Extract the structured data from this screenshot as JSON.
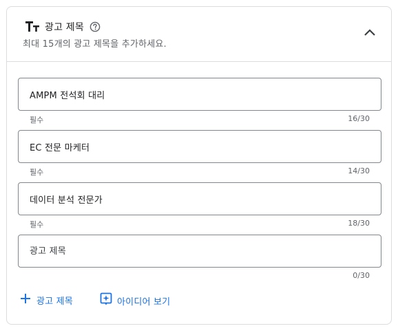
{
  "section": {
    "title": "광고 제목",
    "subtitle": "최대 15개의 광고 제목을 추가하세요.",
    "icons": {
      "type": "text-type-icon",
      "help": "help-icon",
      "collapse": "chevron-up-icon"
    }
  },
  "headlines": [
    {
      "value": "AMPM 전석회 대리",
      "placeholder": "광고 제목",
      "helper": "필수",
      "counter": "16/30"
    },
    {
      "value": "EC 전문 마케터",
      "placeholder": "광고 제목",
      "helper": "필수",
      "counter": "14/30"
    },
    {
      "value": "데이터 분석 전문가",
      "placeholder": "광고 제목",
      "helper": "필수",
      "counter": "18/30"
    },
    {
      "value": "",
      "placeholder": "광고 제목",
      "helper": "",
      "counter": "0/30"
    }
  ],
  "actions": {
    "add_label": "광고 제목",
    "ideas_label": "아이디어 보기"
  },
  "colors": {
    "accent": "#1a73e8",
    "border": "#dadce0",
    "field_border": "#80868b",
    "secondary_text": "#5f6368"
  }
}
